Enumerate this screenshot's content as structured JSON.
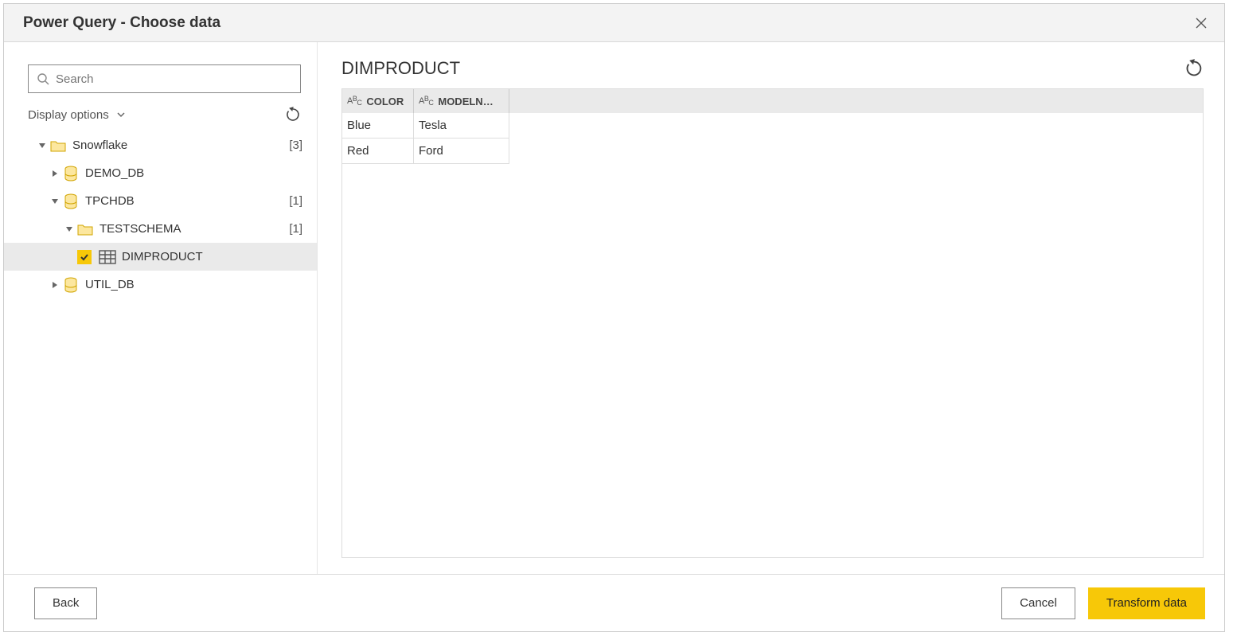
{
  "title": "Power Query - Choose data",
  "search": {
    "placeholder": "Search"
  },
  "displayOptions": {
    "label": "Display options"
  },
  "tree": {
    "root": {
      "label": "Snowflake",
      "count": "[3]"
    },
    "demo": {
      "label": "DEMO_DB"
    },
    "tpch": {
      "label": "TPCHDB",
      "count": "[1]"
    },
    "schema": {
      "label": "TESTSCHEMA",
      "count": "[1]"
    },
    "dimproduct": {
      "label": "DIMPRODUCT"
    },
    "util": {
      "label": "UTIL_DB"
    }
  },
  "preview": {
    "title": "DIMPRODUCT",
    "columns": [
      "COLOR",
      "MODELN…"
    ],
    "rows": [
      {
        "c0": "Blue",
        "c1": "Tesla"
      },
      {
        "c0": "Red",
        "c1": "Ford"
      }
    ]
  },
  "buttons": {
    "back": "Back",
    "cancel": "Cancel",
    "transform": "Transform data"
  }
}
